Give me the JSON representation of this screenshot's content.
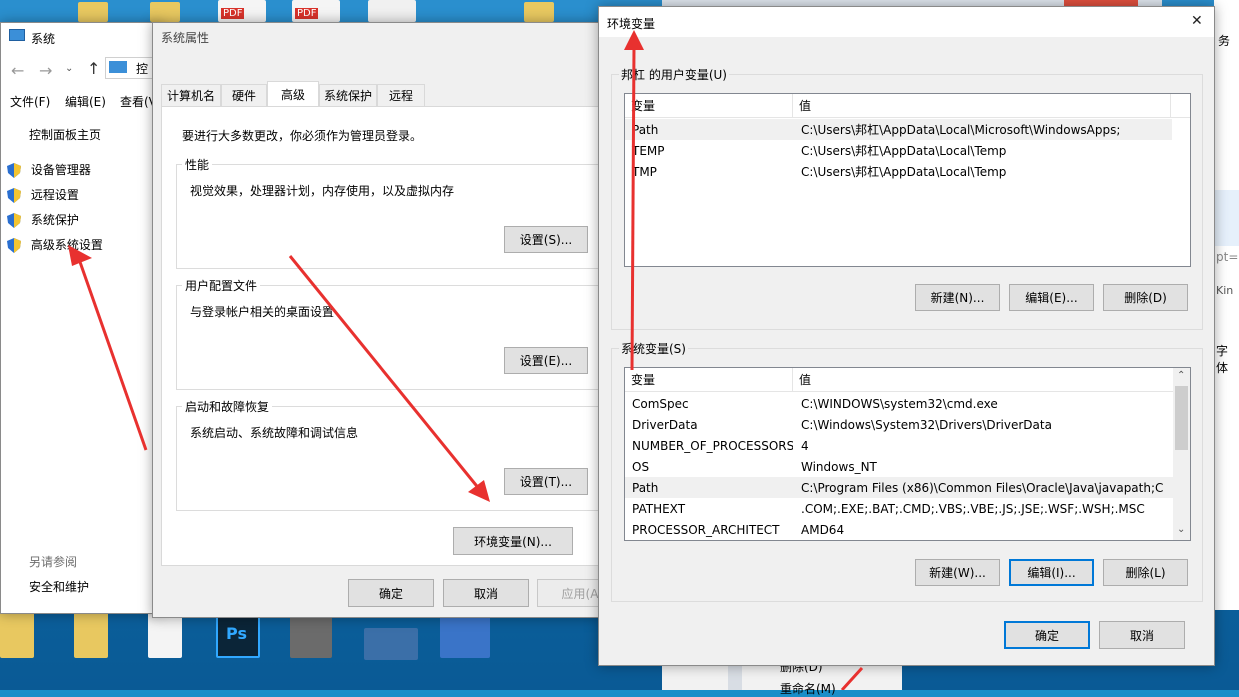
{
  "sysWindow": {
    "title": "系统",
    "menu": [
      "文件(F)",
      "编辑(E)",
      "查看(V"
    ],
    "addressPrefix": "控",
    "home": "控制面板主页",
    "links": [
      "设备管理器",
      "远程设置",
      "系统保护",
      "高级系统设置"
    ],
    "seeAlso": "另请参阅",
    "security": "安全和维护"
  },
  "props": {
    "title": "系统属性",
    "tabs": [
      "计算机名",
      "硬件",
      "高级",
      "系统保护",
      "远程"
    ],
    "adminNote": "要进行大多数更改，你必须作为管理员登录。",
    "performance": {
      "label": "性能",
      "desc": "视觉效果，处理器计划，内存使用，以及虚拟内存",
      "button": "设置(S)..."
    },
    "profile": {
      "label": "用户配置文件",
      "desc": "与登录帐户相关的桌面设置",
      "button": "设置(E)..."
    },
    "startup": {
      "label": "启动和故障恢复",
      "desc": "系统启动、系统故障和调试信息",
      "button": "设置(T)..."
    },
    "envButton": "环境变量(N)...",
    "ok": "确定",
    "cancel": "取消",
    "apply": "应用(A"
  },
  "env": {
    "title": "环境变量",
    "close": "✕",
    "userGroupLabel": "邦杠 的用户变量(U)",
    "colVar": "变量",
    "colVal": "值",
    "userVars": [
      {
        "name": "Path",
        "value": "C:\\Users\\邦杠\\AppData\\Local\\Microsoft\\WindowsApps;"
      },
      {
        "name": "TEMP",
        "value": "C:\\Users\\邦杠\\AppData\\Local\\Temp"
      },
      {
        "name": "TMP",
        "value": "C:\\Users\\邦杠\\AppData\\Local\\Temp"
      }
    ],
    "userButtons": {
      "new": "新建(N)...",
      "edit": "编辑(E)...",
      "delete": "删除(D)"
    },
    "sysGroupLabel": "系统变量(S)",
    "sysVars": [
      {
        "name": "ComSpec",
        "value": "C:\\WINDOWS\\system32\\cmd.exe"
      },
      {
        "name": "DriverData",
        "value": "C:\\Windows\\System32\\Drivers\\DriverData"
      },
      {
        "name": "NUMBER_OF_PROCESSORS",
        "value": "4"
      },
      {
        "name": "OS",
        "value": "Windows_NT"
      },
      {
        "name": "Path",
        "value": "C:\\Program Files (x86)\\Common Files\\Oracle\\Java\\javapath;C:..."
      },
      {
        "name": "PATHEXT",
        "value": ".COM;.EXE;.BAT;.CMD;.VBS;.VBE;.JS;.JSE;.WSF;.WSH;.MSC"
      },
      {
        "name": "PROCESSOR_ARCHITECT",
        "value": "AMD64"
      }
    ],
    "sysButtons": {
      "new": "新建(W)...",
      "edit": "编辑(I)...",
      "delete": "删除(L)"
    },
    "ok": "确定",
    "cancel": "取消"
  },
  "rightEdge": {
    "items": [
      "务",
      "pt=",
      "Kin",
      "字体"
    ]
  },
  "contextMenu": [
    "删除(D)",
    "重命名(M)"
  ],
  "colors": {
    "arrow": "#e8312f",
    "accent": "#0078d7"
  }
}
